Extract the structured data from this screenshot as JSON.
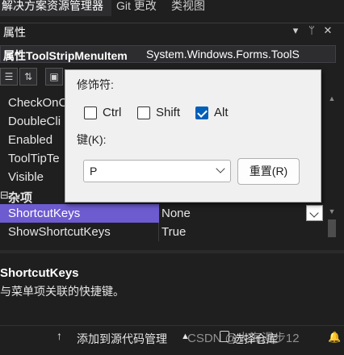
{
  "tabs": [
    {
      "label": "解决方案资源管理器"
    },
    {
      "label": "Git 更改"
    },
    {
      "label": "类视图"
    }
  ],
  "properties_panel": {
    "title": "属性",
    "header_icons": [
      "dropdown-arrow-icon",
      "pin-icon",
      "close-icon"
    ],
    "object_name": "属性ToolStripMenuItem",
    "object_type": "System.Windows.Forms.ToolS"
  },
  "toolbar": {
    "icons": [
      "categorized-icon",
      "alphabetical-icon",
      "properties-icon"
    ]
  },
  "grid": {
    "rows": [
      {
        "name": "CheckOnC",
        "value": ""
      },
      {
        "name": "DoubleCli",
        "value": ""
      },
      {
        "name": "Enabled",
        "value": ""
      },
      {
        "name": "ToolTipTe",
        "value": ""
      },
      {
        "name": "Visible",
        "value": ""
      }
    ],
    "category": {
      "label": "杂项",
      "toggle": "⊟"
    },
    "selected": {
      "name": "ShortcutKeys",
      "value": "None"
    },
    "last": {
      "name": "ShowShortcutKeys",
      "value": "True"
    }
  },
  "description": {
    "title": "ShortcutKeys",
    "text": "与菜单项关联的快捷键。"
  },
  "popup": {
    "modifiers_label": "修饰符:",
    "ctrl_label": "Ctrl",
    "ctrl_checked": false,
    "shift_label": "Shift",
    "shift_checked": false,
    "alt_label": "Alt",
    "alt_checked": true,
    "key_label": "键(K):",
    "key_value": "P",
    "reset_label": "重置(R)"
  },
  "status_bar": {
    "source_control": "添加到源代码管理",
    "repository": "选择仓库",
    "watermark": "CSDN @大海漫步12"
  },
  "colors": {
    "selected_row": "#6d5bd0",
    "checkbox_accent": "#005fb8"
  }
}
